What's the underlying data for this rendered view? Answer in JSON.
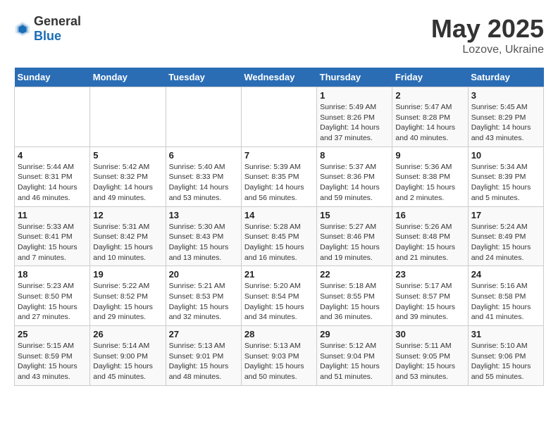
{
  "logo": {
    "text_general": "General",
    "text_blue": "Blue"
  },
  "title": "May 2025",
  "subtitle": "Lozove, Ukraine",
  "days_of_week": [
    "Sunday",
    "Monday",
    "Tuesday",
    "Wednesday",
    "Thursday",
    "Friday",
    "Saturday"
  ],
  "weeks": [
    [
      {
        "day": "",
        "info": ""
      },
      {
        "day": "",
        "info": ""
      },
      {
        "day": "",
        "info": ""
      },
      {
        "day": "",
        "info": ""
      },
      {
        "day": "1",
        "info": "Sunrise: 5:49 AM\nSunset: 8:26 PM\nDaylight: 14 hours\nand 37 minutes."
      },
      {
        "day": "2",
        "info": "Sunrise: 5:47 AM\nSunset: 8:28 PM\nDaylight: 14 hours\nand 40 minutes."
      },
      {
        "day": "3",
        "info": "Sunrise: 5:45 AM\nSunset: 8:29 PM\nDaylight: 14 hours\nand 43 minutes."
      }
    ],
    [
      {
        "day": "4",
        "info": "Sunrise: 5:44 AM\nSunset: 8:31 PM\nDaylight: 14 hours\nand 46 minutes."
      },
      {
        "day": "5",
        "info": "Sunrise: 5:42 AM\nSunset: 8:32 PM\nDaylight: 14 hours\nand 49 minutes."
      },
      {
        "day": "6",
        "info": "Sunrise: 5:40 AM\nSunset: 8:33 PM\nDaylight: 14 hours\nand 53 minutes."
      },
      {
        "day": "7",
        "info": "Sunrise: 5:39 AM\nSunset: 8:35 PM\nDaylight: 14 hours\nand 56 minutes."
      },
      {
        "day": "8",
        "info": "Sunrise: 5:37 AM\nSunset: 8:36 PM\nDaylight: 14 hours\nand 59 minutes."
      },
      {
        "day": "9",
        "info": "Sunrise: 5:36 AM\nSunset: 8:38 PM\nDaylight: 15 hours\nand 2 minutes."
      },
      {
        "day": "10",
        "info": "Sunrise: 5:34 AM\nSunset: 8:39 PM\nDaylight: 15 hours\nand 5 minutes."
      }
    ],
    [
      {
        "day": "11",
        "info": "Sunrise: 5:33 AM\nSunset: 8:41 PM\nDaylight: 15 hours\nand 7 minutes."
      },
      {
        "day": "12",
        "info": "Sunrise: 5:31 AM\nSunset: 8:42 PM\nDaylight: 15 hours\nand 10 minutes."
      },
      {
        "day": "13",
        "info": "Sunrise: 5:30 AM\nSunset: 8:43 PM\nDaylight: 15 hours\nand 13 minutes."
      },
      {
        "day": "14",
        "info": "Sunrise: 5:28 AM\nSunset: 8:45 PM\nDaylight: 15 hours\nand 16 minutes."
      },
      {
        "day": "15",
        "info": "Sunrise: 5:27 AM\nSunset: 8:46 PM\nDaylight: 15 hours\nand 19 minutes."
      },
      {
        "day": "16",
        "info": "Sunrise: 5:26 AM\nSunset: 8:48 PM\nDaylight: 15 hours\nand 21 minutes."
      },
      {
        "day": "17",
        "info": "Sunrise: 5:24 AM\nSunset: 8:49 PM\nDaylight: 15 hours\nand 24 minutes."
      }
    ],
    [
      {
        "day": "18",
        "info": "Sunrise: 5:23 AM\nSunset: 8:50 PM\nDaylight: 15 hours\nand 27 minutes."
      },
      {
        "day": "19",
        "info": "Sunrise: 5:22 AM\nSunset: 8:52 PM\nDaylight: 15 hours\nand 29 minutes."
      },
      {
        "day": "20",
        "info": "Sunrise: 5:21 AM\nSunset: 8:53 PM\nDaylight: 15 hours\nand 32 minutes."
      },
      {
        "day": "21",
        "info": "Sunrise: 5:20 AM\nSunset: 8:54 PM\nDaylight: 15 hours\nand 34 minutes."
      },
      {
        "day": "22",
        "info": "Sunrise: 5:18 AM\nSunset: 8:55 PM\nDaylight: 15 hours\nand 36 minutes."
      },
      {
        "day": "23",
        "info": "Sunrise: 5:17 AM\nSunset: 8:57 PM\nDaylight: 15 hours\nand 39 minutes."
      },
      {
        "day": "24",
        "info": "Sunrise: 5:16 AM\nSunset: 8:58 PM\nDaylight: 15 hours\nand 41 minutes."
      }
    ],
    [
      {
        "day": "25",
        "info": "Sunrise: 5:15 AM\nSunset: 8:59 PM\nDaylight: 15 hours\nand 43 minutes."
      },
      {
        "day": "26",
        "info": "Sunrise: 5:14 AM\nSunset: 9:00 PM\nDaylight: 15 hours\nand 45 minutes."
      },
      {
        "day": "27",
        "info": "Sunrise: 5:13 AM\nSunset: 9:01 PM\nDaylight: 15 hours\nand 48 minutes."
      },
      {
        "day": "28",
        "info": "Sunrise: 5:13 AM\nSunset: 9:03 PM\nDaylight: 15 hours\nand 50 minutes."
      },
      {
        "day": "29",
        "info": "Sunrise: 5:12 AM\nSunset: 9:04 PM\nDaylight: 15 hours\nand 51 minutes."
      },
      {
        "day": "30",
        "info": "Sunrise: 5:11 AM\nSunset: 9:05 PM\nDaylight: 15 hours\nand 53 minutes."
      },
      {
        "day": "31",
        "info": "Sunrise: 5:10 AM\nSunset: 9:06 PM\nDaylight: 15 hours\nand 55 minutes."
      }
    ]
  ]
}
